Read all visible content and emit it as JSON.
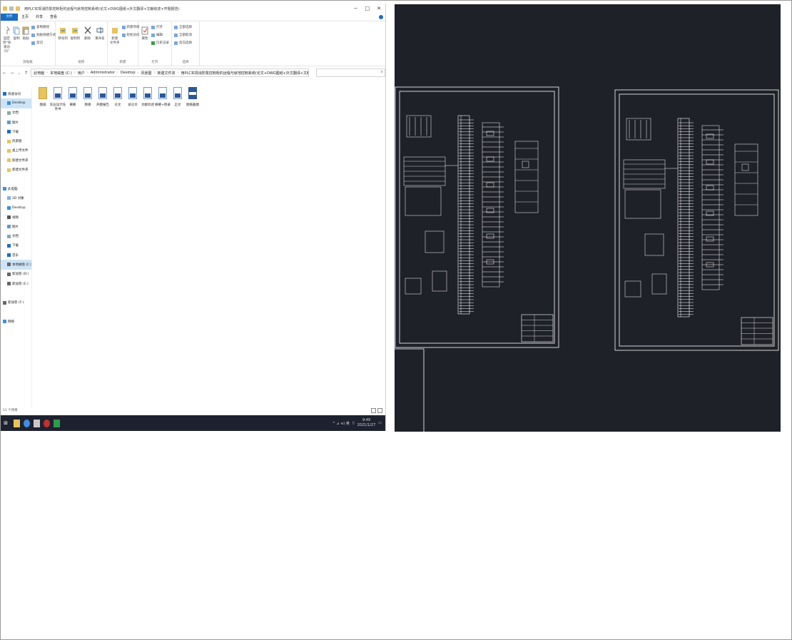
{
  "explorer": {
    "title": "用PLC实现消防泵控制柜的远程与就地控制系统(论文+DWG图纸+外文翻译+文献综述+开题报告)",
    "window_buttons": [
      "−",
      "□",
      "✕"
    ],
    "ribbon_tabs": [
      "文件",
      "主页",
      "共享",
      "查看"
    ],
    "ribbon": {
      "clipboard": {
        "pin": "固定到\"快速访问\"",
        "copy": "复制",
        "paste": "粘贴",
        "copy_path": "复制路径",
        "paste_shortcut": "粘贴快捷方式",
        "cut": "剪切",
        "label": "剪贴板"
      },
      "organize": {
        "move_to": "移动到",
        "copy_to": "复制到",
        "delete": "删除",
        "rename": "重命名",
        "label": "组织"
      },
      "new": {
        "new_folder": "新建\n文件夹",
        "new_item": "新建项目",
        "easy_access": "轻松访问",
        "label": "新建"
      },
      "open": {
        "properties": "属性",
        "open": "打开",
        "edit": "编辑",
        "history": "历史记录",
        "label": "打开"
      },
      "select": {
        "select_all": "全部选择",
        "select_none": "全部取消",
        "invert": "反向选择",
        "label": "选择"
      }
    },
    "address": {
      "crumbs": [
        "此电脑",
        "本地磁盘 (C:)",
        "用户",
        "Administrator",
        "Desktop",
        "风景图",
        "新建文件夹",
        "用PLC实现消防泵控制柜的远程与就地控制系统(论文+DWG图纸+外文翻译+文献综述+开题报告)"
      ]
    },
    "nav": [
      {
        "label": "快速访问",
        "kind": "star",
        "indent": false
      },
      {
        "label": "Desktop",
        "kind": "desktop",
        "indent": true,
        "selected": true
      },
      {
        "label": "文档",
        "kind": "doc",
        "indent": true
      },
      {
        "label": "图片",
        "kind": "pic",
        "indent": true
      },
      {
        "label": "下载",
        "kind": "down",
        "indent": true
      },
      {
        "label": "风景图",
        "kind": "folder",
        "indent": true
      },
      {
        "label": "桌上传文件",
        "kind": "folder",
        "indent": true
      },
      {
        "label": "新建文件夹",
        "kind": "folder",
        "indent": true
      },
      {
        "label": "新建文件夹",
        "kind": "folder",
        "indent": true
      },
      {
        "label": "",
        "kind": "none",
        "indent": false
      },
      {
        "label": "此电脑",
        "kind": "pc",
        "indent": false
      },
      {
        "label": "3D 对象",
        "kind": "obj",
        "indent": true
      },
      {
        "label": "Desktop",
        "kind": "desktop",
        "indent": true
      },
      {
        "label": "视频",
        "kind": "vid",
        "indent": true
      },
      {
        "label": "图片",
        "kind": "pic",
        "indent": true
      },
      {
        "label": "文档",
        "kind": "doc",
        "indent": true
      },
      {
        "label": "下载",
        "kind": "down",
        "indent": true
      },
      {
        "label": "音乐",
        "kind": "music",
        "indent": true
      },
      {
        "label": "本地磁盘 (C:)",
        "kind": "drive",
        "indent": true,
        "selected": true
      },
      {
        "label": "新加卷 (D:)",
        "kind": "drive",
        "indent": true
      },
      {
        "label": "新加卷 (E:)",
        "kind": "drive",
        "indent": true
      },
      {
        "label": "",
        "kind": "none",
        "indent": false
      },
      {
        "label": "新加卷 (F:)",
        "kind": "drive",
        "indent": false
      },
      {
        "label": "",
        "kind": "none",
        "indent": false
      },
      {
        "label": "网络",
        "kind": "net",
        "indent": false
      }
    ],
    "files": [
      {
        "name": "图纸",
        "type": "folder"
      },
      {
        "name": "毕业设计任务书",
        "type": "doc"
      },
      {
        "name": "摘要",
        "type": "doc"
      },
      {
        "name": "致谢",
        "type": "doc"
      },
      {
        "name": "开题报告",
        "type": "doc"
      },
      {
        "name": "论文",
        "type": "doc"
      },
      {
        "name": "总论文",
        "type": "doc"
      },
      {
        "name": "文献综述",
        "type": "doc"
      },
      {
        "name": "摘要+目录",
        "type": "doc"
      },
      {
        "name": "正文",
        "type": "doc"
      },
      {
        "name": "图纸截图",
        "type": "image"
      }
    ],
    "status": "11 个项目",
    "taskbar": {
      "tray_text": "^ ⊿ ⊲) 英",
      "time": "9:49",
      "date": "2021/1/27"
    }
  },
  "cad": {
    "background": "#1e2128",
    "line_color": "#ffffff"
  }
}
